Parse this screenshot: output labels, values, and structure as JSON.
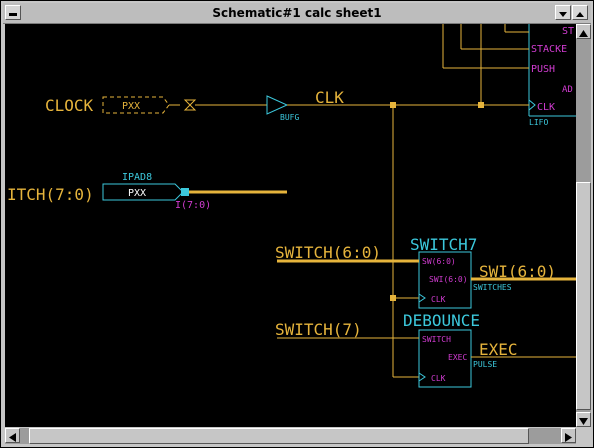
{
  "window": {
    "title": "Schematic#1 calc sheet1"
  },
  "colors": {
    "net": "#e6b43c",
    "component": "#3cc8dc",
    "pin": "#d23cd2",
    "background": "#000000"
  },
  "schematic": {
    "clock_port": "CLOCK",
    "clock_pad": "PXX",
    "bufg_label": "BUFG",
    "clk_net": "CLK",
    "itch_port": "ITCH(7:0)",
    "ipad_label": "IPAD8",
    "ipad_pad": "PXX",
    "ipad_pin": "I(7:0)",
    "lifo_pins": [
      "ST",
      "STACKE",
      "PUSH",
      "CLK"
    ],
    "lifo_ad": "AD",
    "lifo_label": "LIFO",
    "switch_net": "SWITCH(6:0)",
    "switch7_label": "SWITCH7",
    "switch7_pin_in": "SW(6:0)",
    "switch7_pin_out": "SWI(6:0)",
    "switch7_pin_clk": "CLK",
    "switch7_sub": "SWITCHES",
    "swi_net": "SWI(6:0)",
    "switch7_net": "SWITCH(7)",
    "debounce_label": "DEBOUNCE",
    "debounce_pin_in": "SWITCH",
    "debounce_pin_out": "EXEC",
    "debounce_pin_clk": "CLK",
    "debounce_sub": "PULSE",
    "exec_net": "EXEC"
  },
  "scrollbars": {
    "up_icon": "arrow-up-icon",
    "down_icon": "arrow-down-icon",
    "left_icon": "arrow-left-icon",
    "right_icon": "arrow-right-icon"
  }
}
